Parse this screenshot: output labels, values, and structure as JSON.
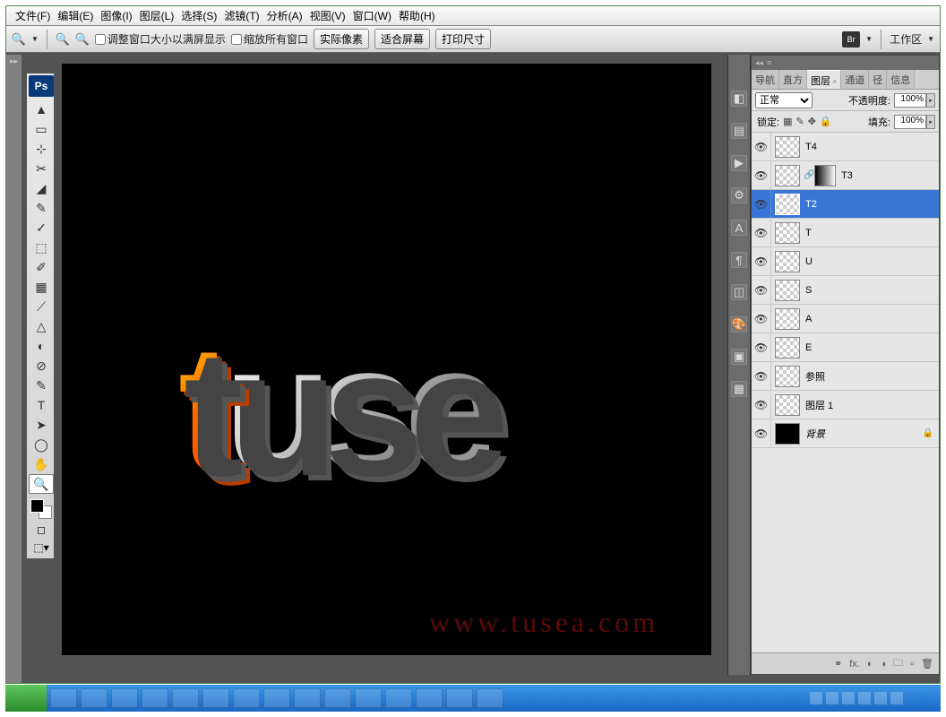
{
  "menubar": {
    "file": "文件(F)",
    "edit": "编辑(E)",
    "image": "图像(I)",
    "layer": "图层(L)",
    "select": "选择(S)",
    "filter": "滤镜(T)",
    "analysis": "分析(A)",
    "view": "视图(V)",
    "window": "窗口(W)",
    "help": "帮助(H)"
  },
  "options": {
    "resize_to_fit": "调整窗口大小以满屏显示",
    "zoom_all": "缩放所有窗口",
    "actual": "实际像素",
    "fit": "适合屏幕",
    "print": "打印尺寸",
    "workspace": "工作区"
  },
  "panel": {
    "tabs": {
      "navigator": "导航",
      "histogram": "直方",
      "layers": "图层",
      "channels": "通道",
      "paths": "径",
      "info": "信息"
    },
    "blend_label": "正常",
    "opacity_label": "不透明度:",
    "opacity_value": "100%",
    "lock_label": "锁定:",
    "fill_label": "填充:",
    "fill_value": "100%"
  },
  "layers": [
    {
      "name": "T4",
      "sel": false,
      "mask": false,
      "bg": false
    },
    {
      "name": "T3",
      "sel": false,
      "mask": true,
      "bg": false
    },
    {
      "name": "T2",
      "sel": true,
      "mask": false,
      "bg": false
    },
    {
      "name": "T",
      "sel": false,
      "mask": false,
      "bg": false
    },
    {
      "name": "U",
      "sel": false,
      "mask": false,
      "bg": false
    },
    {
      "name": "S",
      "sel": false,
      "mask": false,
      "bg": false
    },
    {
      "name": "A",
      "sel": false,
      "mask": false,
      "bg": false
    },
    {
      "name": "E",
      "sel": false,
      "mask": false,
      "bg": false
    },
    {
      "name": "参照",
      "sel": false,
      "mask": false,
      "bg": false
    },
    {
      "name": "图层 1",
      "sel": false,
      "mask": false,
      "bg": false
    },
    {
      "name": "背景",
      "sel": false,
      "mask": false,
      "bg": true
    }
  ],
  "canvas": {
    "watermark": "www.tusea.com",
    "art_t": "t",
    "art_rest": "use"
  },
  "tools": [
    "▲",
    "▭",
    "⊹",
    "✂",
    "◢",
    "✎",
    "✓",
    "⬚",
    "✐",
    "▦",
    "⟋",
    "△",
    "◐",
    "⊘",
    "✎",
    "T",
    "➤",
    "◯",
    "✋",
    "🔍"
  ]
}
